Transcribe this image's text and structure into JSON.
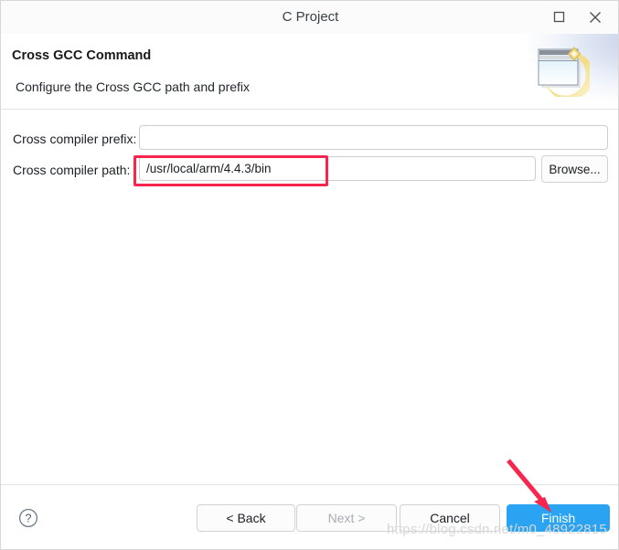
{
  "window": {
    "title": "C Project",
    "maximize_icon": "maximize-icon",
    "close_icon": "close-icon"
  },
  "banner": {
    "title": "Cross GCC Command",
    "subtitle": "Configure the Cross GCC path and prefix",
    "icon": "wizard-window-sparkle-icon"
  },
  "form": {
    "prefix": {
      "label": "Cross compiler prefix:",
      "value": "",
      "placeholder": ""
    },
    "path": {
      "label": "Cross compiler path:",
      "value": "/usr/local/arm/4.4.3/bin",
      "placeholder": ""
    },
    "browse_label": "Browse..."
  },
  "footer": {
    "help_icon": "help-question-icon",
    "back_label": "< Back",
    "next_label": "Next >",
    "cancel_label": "Cancel",
    "finish_label": "Finish"
  },
  "annotations": {
    "highlight_box": "red-rectangle-around-compiler-path",
    "arrow": "red-arrow-pointing-to-finish",
    "accent_red": "#f8264f",
    "accent_blue": "#2aa3f2"
  },
  "watermark": {
    "text": "https://blog.csdn.net/m0_48922815"
  }
}
